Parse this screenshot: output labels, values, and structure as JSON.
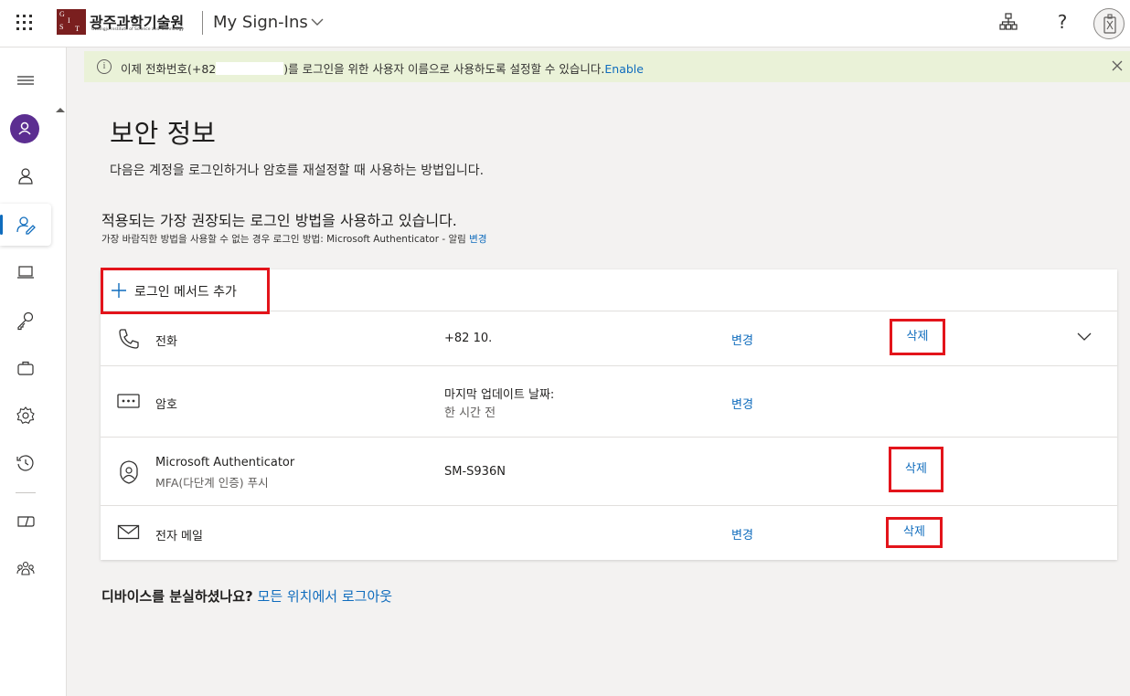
{
  "header": {
    "logo_kr": "광주과학기술원",
    "logo_en": "Gwangju Institute of Science and Technology",
    "logo_letters": [
      "G",
      "I",
      "S",
      "T"
    ],
    "app_title": "My Sign-Ins",
    "help_label": "?"
  },
  "banner": {
    "info_glyph": "i",
    "text_before": "이제 전화번호(+82",
    "text_after": ")를 로그인을 위한 사용자 이름으로 사용하도록 설정할 수 있습니다.",
    "link": "Enable"
  },
  "page": {
    "title": "보안 정보",
    "subtitle": "다음은 계정을 로그인하거나 암호를 재설정할 때 사용하는 방법입니다."
  },
  "section": {
    "title": "적용되는 가장 권장되는 로그인 방법을 사용하고 있습니다.",
    "subtitle": "가장 바람직한 방법을 사용할 수 없는 경우 로그인 방법: Microsoft Authenticator - 알림",
    "subtitle_link": "변경"
  },
  "add_method": {
    "label": "로그인 메서드 추가"
  },
  "methods": [
    {
      "name": "전화",
      "detail": "+82 10.",
      "change": "변경",
      "delete": "삭제",
      "icon": "phone-icon"
    },
    {
      "name": "암호",
      "detail": "마지막 업데이트 날짜:",
      "detail2": "한 시간 전",
      "change": "변경",
      "icon": "password-icon"
    },
    {
      "name": "Microsoft Authenticator",
      "name2": "MFA(다단계 인증) 푸시",
      "detail": "SM-S936N",
      "delete": "삭제",
      "icon": "authenticator-icon"
    },
    {
      "name": "전자 메일",
      "change": "변경",
      "delete": "삭제",
      "icon": "mail-icon"
    }
  ],
  "lost_device": {
    "question": "디바이스를 분실하셨나요?",
    "link": "모든 위치에서 로그아웃"
  },
  "rail": {
    "items": [
      "menu-icon",
      "account-avatar",
      "person-icon",
      "security-info-icon",
      "devices-icon",
      "password-icon",
      "organizations-icon",
      "settings-icon",
      "recent-activity-icon",
      "office-apps-icon",
      "subscriptions-icon"
    ]
  },
  "colors": {
    "accent": "#0f6cbd",
    "highlight_red": "#e3141b",
    "banner_bg": "#eaf2d8",
    "avatar_purple": "#5c2e91"
  }
}
